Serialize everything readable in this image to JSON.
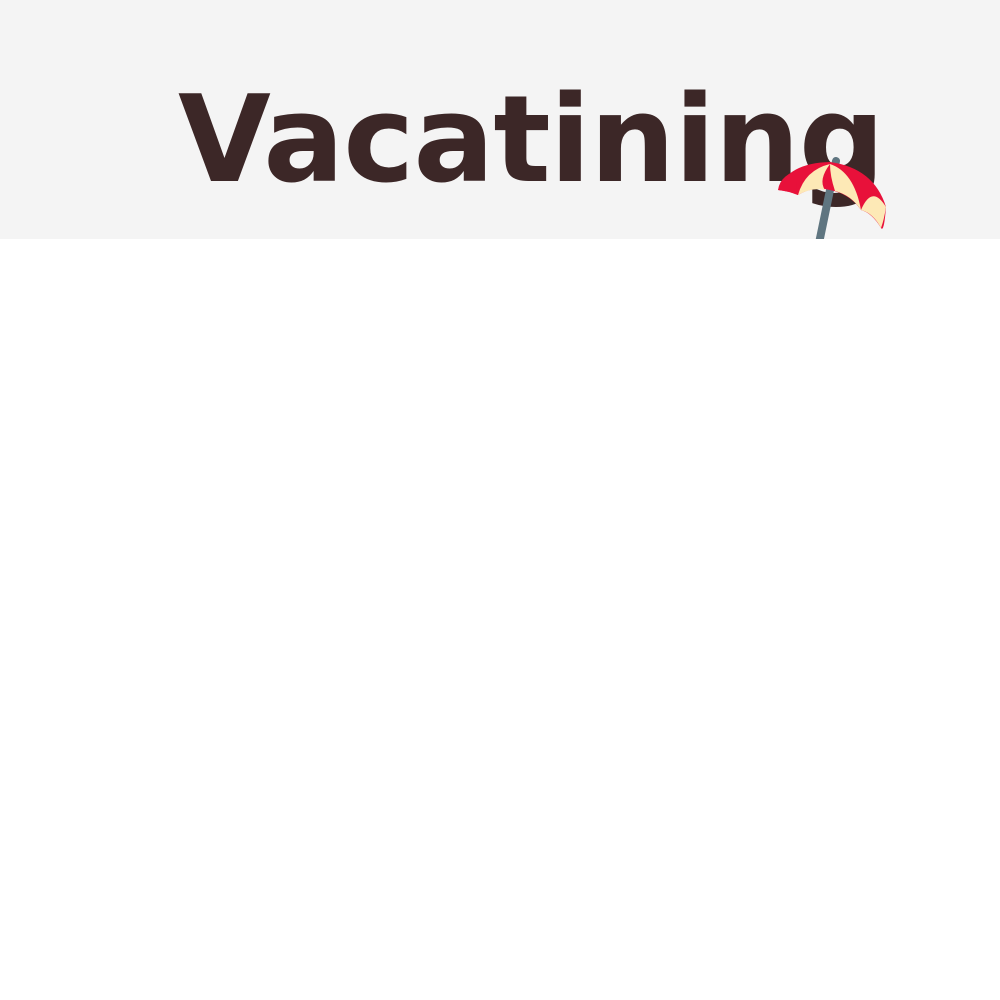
{
  "header": {
    "title": "Vacatining",
    "icon": "island-with-umbrella-icon"
  },
  "colors": {
    "header_background": "#f4f4f4",
    "title_text": "#3c2727",
    "page_background": "#ffffff",
    "umbrella_red": "#e8113a",
    "umbrella_cream": "#fde9b6",
    "umbrella_pole": "#5f7580",
    "sand": "#f7951d",
    "water": "#1d8ccb",
    "water_light": "#5cb8ea"
  }
}
